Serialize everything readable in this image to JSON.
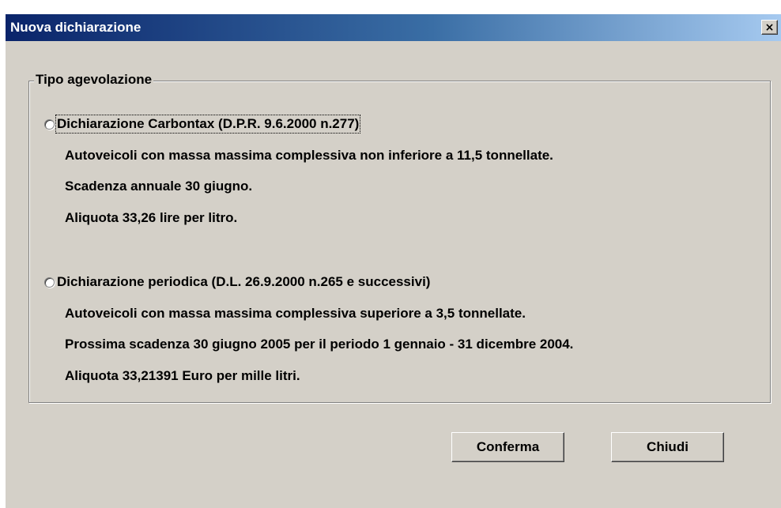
{
  "window": {
    "title": "Nuova dichiarazione",
    "close_glyph": "×"
  },
  "group": {
    "legend": "Tipo agevolazione"
  },
  "options": [
    {
      "label": "Dichiarazione Carbontax (D.P.R. 9.6.2000 n.277)",
      "selected": false,
      "focused": true,
      "lines": [
        "Autoveicoli con massa massima complessiva non inferiore a 11,5 tonnellate.",
        "Scadenza annuale 30 giugno.",
        "Aliquota 33,26 lire per litro."
      ]
    },
    {
      "label": "Dichiarazione periodica (D.L. 26.9.2000 n.265 e successivi)",
      "selected": false,
      "focused": false,
      "lines": [
        "Autoveicoli con massa massima complessiva superiore a 3,5 tonnellate.",
        "Prossima scadenza 30 giugno 2005 per il periodo 1 gennaio - 31 dicembre 2004.",
        "Aliquota 33,21391 Euro per mille litri."
      ]
    }
  ],
  "buttons": {
    "confirm": "Conferma",
    "close": "Chiudi"
  },
  "colors": {
    "title_gradient_start": "#0a246a",
    "title_gradient_end": "#a6caf0",
    "face": "#d4d0c8"
  }
}
